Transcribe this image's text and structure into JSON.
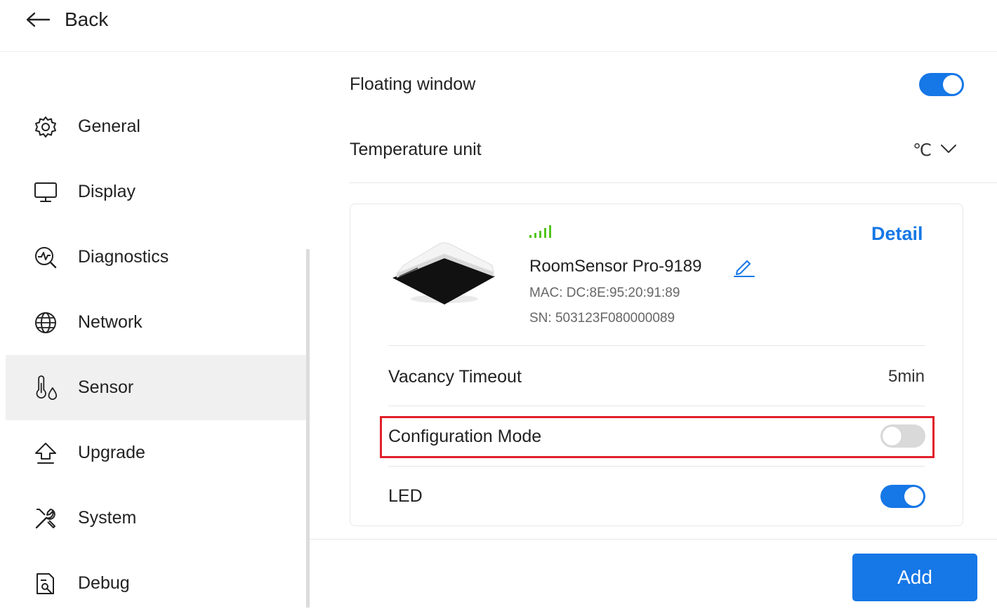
{
  "header": {
    "back_label": "Back"
  },
  "sidebar": {
    "items": [
      {
        "label": "General"
      },
      {
        "label": "Display"
      },
      {
        "label": "Diagnostics"
      },
      {
        "label": "Network"
      },
      {
        "label": "Sensor",
        "active": true
      },
      {
        "label": "Upgrade"
      },
      {
        "label": "System"
      },
      {
        "label": "Debug"
      }
    ]
  },
  "settings": {
    "floating_window": {
      "label": "Floating window",
      "enabled": true
    },
    "temperature_unit": {
      "label": "Temperature unit",
      "value": "℃"
    }
  },
  "sensor_card": {
    "name": "RoomSensor Pro-9189",
    "mac": "MAC: DC:8E:95:20:91:89",
    "sn": "SN: 503123F080000089",
    "detail_label": "Detail",
    "vacancy_timeout": {
      "label": "Vacancy Timeout",
      "value": "5min"
    },
    "configuration_mode": {
      "label": "Configuration Mode",
      "enabled": false
    },
    "led": {
      "label": "LED",
      "enabled": true
    }
  },
  "add_button_label": "Add",
  "colors": {
    "accent": "#1677e6",
    "signal": "#52c41a",
    "highlight": "#e0202a",
    "active_bg": "#f0f0f0"
  }
}
